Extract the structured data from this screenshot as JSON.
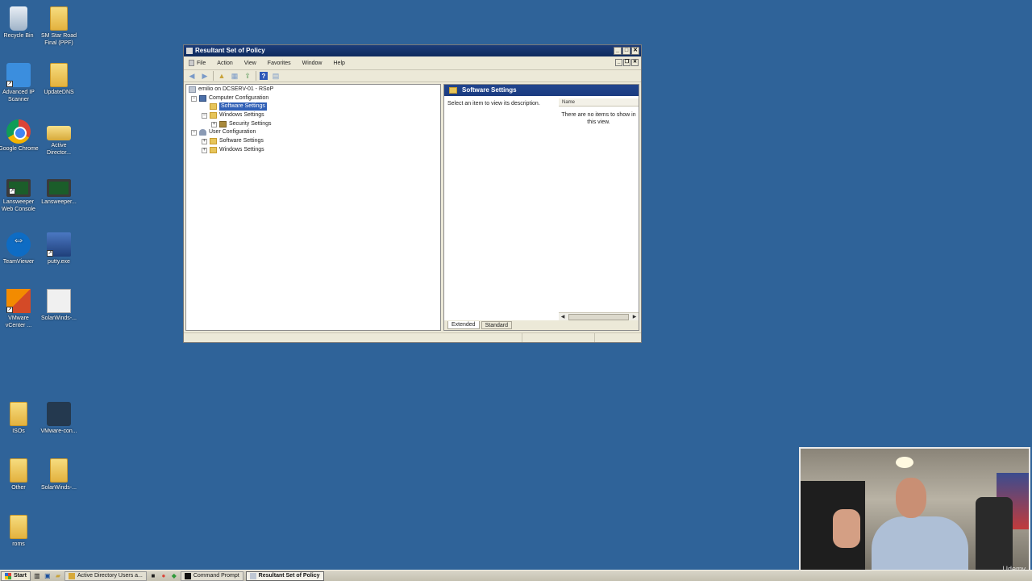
{
  "desktop": {
    "icons": [
      {
        "label": "Recycle Bin",
        "icon": "recycle-bin-icon"
      },
      {
        "label": "SM Star Road Final (PPF)",
        "icon": "folder-icon"
      },
      {
        "label": "Advanced IP Scanner",
        "icon": "ip-scanner-icon"
      },
      {
        "label": "UpdateDNS",
        "icon": "folder-icon"
      },
      {
        "label": "Google Chrome",
        "icon": "chrome-icon"
      },
      {
        "label": "Active Director...",
        "icon": "active-directory-icon"
      },
      {
        "label": "Lansweeper Web Console",
        "icon": "monitor-icon"
      },
      {
        "label": "Lansweeper...",
        "icon": "monitor-icon"
      },
      {
        "label": "TeamViewer",
        "icon": "teamviewer-icon"
      },
      {
        "label": "putty.exe",
        "icon": "putty-icon"
      },
      {
        "label": "VMware vCenter ...",
        "icon": "vmware-icon"
      },
      {
        "label": "SolarWinds-...",
        "icon": "solarwinds-icon"
      },
      {
        "label": "ISOs",
        "icon": "folder-icon"
      },
      {
        "label": "VMware-con...",
        "icon": "vmware-console-icon"
      },
      {
        "label": "Other",
        "icon": "folder-icon"
      },
      {
        "label": "SolarWinds-...",
        "icon": "folder-icon"
      },
      {
        "label": "roms",
        "icon": "folder-icon"
      }
    ]
  },
  "window": {
    "title": "Resultant Set of Policy",
    "menu": [
      "File",
      "Action",
      "View",
      "Favorites",
      "Window",
      "Help"
    ],
    "tree": {
      "root": "emilio on DCSERV-01 - RSoP",
      "computer_config": "Computer Configuration",
      "cc_software": "Software Settings",
      "cc_windows": "Windows Settings",
      "cc_security": "Security Settings",
      "user_config": "User Configuration",
      "uc_software": "Software Settings",
      "uc_windows": "Windows Settings"
    },
    "right_pane": {
      "header": "Software Settings",
      "description": "Select an item to view its description.",
      "column_name": "Name",
      "empty_message": "There are no items to show in this view."
    },
    "tabs": [
      "Extended",
      "Standard"
    ]
  },
  "webcam": {
    "watermark": "Udemy"
  },
  "taskbar": {
    "start": "Start",
    "tasks": [
      {
        "label": "Active Directory Users a...",
        "active": false
      },
      {
        "label": "Command Prompt",
        "active": false
      },
      {
        "label": "Resultant Set of Policy",
        "active": true
      }
    ]
  },
  "colors": {
    "desktop_bg": "#2f6399",
    "title_bar": "#0f2b5e",
    "selection": "#2f5fb6"
  }
}
